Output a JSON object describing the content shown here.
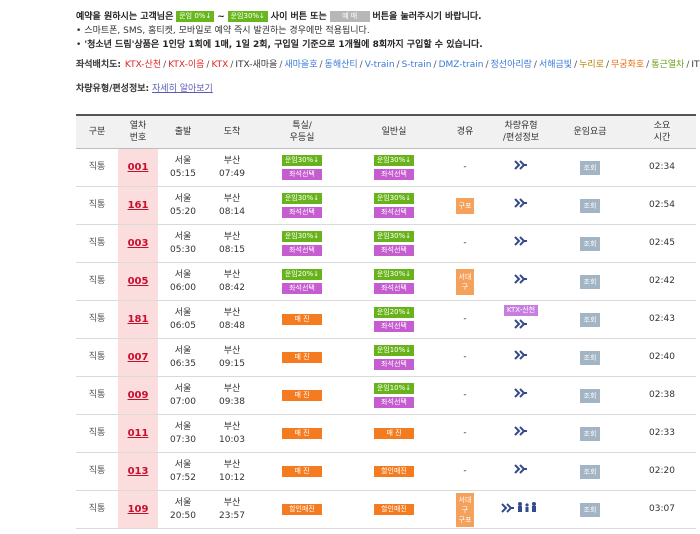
{
  "notice": {
    "line1_pre": "예약을 원하시는 고객님은",
    "tag_a": "운임 0%↓",
    "tilde": "~",
    "tag_b": "운임30%↓",
    "line1_mid": "사이 버튼 또는",
    "tag_c": "예 매",
    "line1_post": "버튼을 눌러주시기 바랍니다.",
    "line2": "스마트폰, SMS, 홈티켓, 모바일로 예약 즉시 발권하는 경우에만 적용됩니다.",
    "line3": "'청소년 드림'상품은 1인당 1회에 1매, 1일 2회, 구입일 기준으로 1개월에 8회까지 구입할 수 있습니다."
  },
  "legend": {
    "title": "좌석배치도:",
    "items": [
      {
        "label": "KTX-산천",
        "color": "#e32424"
      },
      {
        "label": "KTX-이음",
        "color": "#e32424"
      },
      {
        "label": "KTX",
        "color": "#e32424"
      },
      {
        "label": "ITX-새마을",
        "color": "#333333"
      },
      {
        "label": "새마을호",
        "color": "#3a78d8"
      },
      {
        "label": "동해산티",
        "color": "#3a78d8"
      },
      {
        "label": "V-train",
        "color": "#3a78d8"
      },
      {
        "label": "S-train",
        "color": "#3a78d8"
      },
      {
        "label": "DMZ-train",
        "color": "#3a78d8"
      },
      {
        "label": "정선아리랑",
        "color": "#3a78d8"
      },
      {
        "label": "서해금빛",
        "color": "#3a78d8"
      },
      {
        "label": "누리로",
        "color": "#b08400"
      },
      {
        "label": "무궁화호",
        "color": "#e86b12"
      },
      {
        "label": "통근열차",
        "color": "#6aa118"
      },
      {
        "label": "ITX-청춘",
        "color": "#333333"
      }
    ],
    "sep": "/"
  },
  "vehicle": {
    "title": "차량유형/편성정보:",
    "link": "자세히 알아보기"
  },
  "table": {
    "headers": [
      {
        "l1": "구분",
        "l2": ""
      },
      {
        "l1": "열차",
        "l2": "번호"
      },
      {
        "l1": "출발",
        "l2": ""
      },
      {
        "l1": "도착",
        "l2": ""
      },
      {
        "l1": "특실/",
        "l2": "우등실"
      },
      {
        "l1": "일반실",
        "l2": ""
      },
      {
        "l1": "경유",
        "l2": ""
      },
      {
        "l1": "차량유형",
        "l2": "/편성정보"
      },
      {
        "l1": "운임요금",
        "l2": ""
      },
      {
        "l1": "소요",
        "l2": "시간"
      }
    ],
    "rows": [
      {
        "type": "직통",
        "no": "001",
        "dep_st": "서울",
        "dep_t": "05:15",
        "arr_st": "부산",
        "arr_t": "07:49",
        "first": [
          {
            "t": "운임30%↓",
            "c": "green"
          },
          {
            "t": "좌석선택",
            "c": "purple"
          }
        ],
        "std": [
          {
            "t": "운임30%↓",
            "c": "green"
          },
          {
            "t": "좌석선택",
            "c": "purple"
          }
        ],
        "via": "-",
        "veh": [
          "seat"
        ],
        "fare": "조회",
        "dur": "02:34"
      },
      {
        "type": "직통",
        "no": "161",
        "dep_st": "서울",
        "dep_t": "05:20",
        "arr_st": "부산",
        "arr_t": "08:14",
        "first": [
          {
            "t": "운임30%↓",
            "c": "green"
          },
          {
            "t": "좌석선택",
            "c": "purple"
          }
        ],
        "std": [
          {
            "t": "운임30%↓",
            "c": "green"
          },
          {
            "t": "좌석선택",
            "c": "purple"
          }
        ],
        "via": "구포",
        "veh": [
          "seat"
        ],
        "fare": "조회",
        "dur": "02:54"
      },
      {
        "type": "직통",
        "no": "003",
        "dep_st": "서울",
        "dep_t": "05:30",
        "arr_st": "부산",
        "arr_t": "08:15",
        "first": [
          {
            "t": "운임30%↓",
            "c": "green"
          },
          {
            "t": "좌석선택",
            "c": "purple"
          }
        ],
        "std": [
          {
            "t": "운임30%↓",
            "c": "green"
          },
          {
            "t": "좌석선택",
            "c": "purple"
          }
        ],
        "via": "-",
        "veh": [
          "seat"
        ],
        "fare": "조회",
        "dur": "02:45"
      },
      {
        "type": "직통",
        "no": "005",
        "dep_st": "서울",
        "dep_t": "06:00",
        "arr_st": "부산",
        "arr_t": "08:42",
        "first": [
          {
            "t": "운임20%↓",
            "c": "green"
          },
          {
            "t": "좌석선택",
            "c": "purple"
          }
        ],
        "std": [
          {
            "t": "운임30%↓",
            "c": "green"
          },
          {
            "t": "좌석선택",
            "c": "purple"
          }
        ],
        "via": "서대구",
        "veh": [
          "seat"
        ],
        "fare": "조회",
        "dur": "02:42"
      },
      {
        "type": "직통",
        "no": "181",
        "dep_st": "서울",
        "dep_t": "06:05",
        "arr_st": "부산",
        "arr_t": "08:48",
        "first": [
          {
            "t": "매 진",
            "c": "orange"
          }
        ],
        "std": [
          {
            "t": "운임20%↓",
            "c": "green"
          },
          {
            "t": "좌석선택",
            "c": "purple"
          }
        ],
        "via": "-",
        "veh": [
          "ktx",
          "seat"
        ],
        "ktx_label": "KTX-산천",
        "fare": "조회",
        "dur": "02:43"
      },
      {
        "type": "직통",
        "no": "007",
        "dep_st": "서울",
        "dep_t": "06:35",
        "arr_st": "부산",
        "arr_t": "09:15",
        "first": [
          {
            "t": "매 진",
            "c": "orange"
          }
        ],
        "std": [
          {
            "t": "운임10%↓",
            "c": "green"
          },
          {
            "t": "좌석선택",
            "c": "purple"
          }
        ],
        "via": "-",
        "veh": [
          "seat"
        ],
        "fare": "조회",
        "dur": "02:40"
      },
      {
        "type": "직통",
        "no": "009",
        "dep_st": "서울",
        "dep_t": "07:00",
        "arr_st": "부산",
        "arr_t": "09:38",
        "first": [
          {
            "t": "매 진",
            "c": "orange"
          }
        ],
        "std": [
          {
            "t": "운임10%↓",
            "c": "green"
          },
          {
            "t": "좌석선택",
            "c": "purple"
          }
        ],
        "via": "-",
        "veh": [
          "seat"
        ],
        "fare": "조회",
        "dur": "02:38"
      },
      {
        "type": "직통",
        "no": "011",
        "dep_st": "서울",
        "dep_t": "07:30",
        "arr_st": "부산",
        "arr_t": "10:03",
        "first": [
          {
            "t": "매 진",
            "c": "orange"
          }
        ],
        "std": [
          {
            "t": "매 진",
            "c": "orange"
          }
        ],
        "via": "-",
        "veh": [
          "seat"
        ],
        "fare": "조회",
        "dur": "02:33"
      },
      {
        "type": "직통",
        "no": "013",
        "dep_st": "서울",
        "dep_t": "07:52",
        "arr_st": "부산",
        "arr_t": "10:12",
        "first": [
          {
            "t": "매 진",
            "c": "orange"
          }
        ],
        "std": [
          {
            "t": "할인매진",
            "c": "orange"
          }
        ],
        "via": "-",
        "veh": [
          "seat"
        ],
        "fare": "조회",
        "dur": "02:20"
      },
      {
        "type": "직통",
        "no": "109",
        "dep_st": "서울",
        "dep_t": "20:50",
        "arr_st": "부산",
        "arr_t": "23:57",
        "first": [
          {
            "t": "할인매진",
            "c": "orange"
          }
        ],
        "std": [
          {
            "t": "할인매진",
            "c": "orange"
          }
        ],
        "via": "서대구 구포",
        "veh": [
          "seat",
          "family"
        ],
        "fare": "조회",
        "dur": "03:07"
      }
    ]
  }
}
